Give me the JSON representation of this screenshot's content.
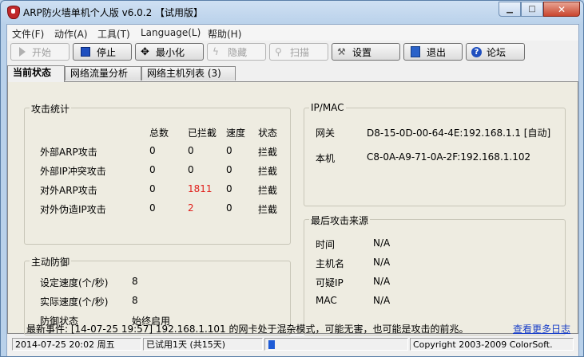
{
  "window": {
    "title": "ARP防火墙单机个人版 v6.0.2 【试用版】"
  },
  "menu": [
    "文件(F)",
    "动作(A)",
    "工具(T)",
    "Language(L)",
    "帮助(H)"
  ],
  "toolbar": {
    "start": "开始",
    "stop": "停止",
    "minimize": "最小化",
    "hide": "隐藏",
    "scan": "扫描",
    "settings": "设置",
    "exit": "退出",
    "forum": "论坛"
  },
  "tabs": [
    "当前状态",
    "网络流量分析",
    "网络主机列表 (3)"
  ],
  "attack_stats": {
    "title": "攻击统计",
    "headers": [
      "总数",
      "已拦截",
      "速度",
      "状态"
    ],
    "rows": [
      {
        "name": "外部ARP攻击",
        "total": "0",
        "blocked": "0",
        "speed": "0",
        "status": "拦截"
      },
      {
        "name": "外部IP冲突攻击",
        "total": "0",
        "blocked": "0",
        "speed": "0",
        "status": "拦截"
      },
      {
        "name": "对外ARP攻击",
        "total": "0",
        "blocked": "1811",
        "speed": "0",
        "status": "拦截"
      },
      {
        "name": "对外伪造IP攻击",
        "total": "0",
        "blocked": "2",
        "speed": "0",
        "status": "拦截"
      }
    ]
  },
  "ipmac": {
    "title": "IP/MAC",
    "gateway_label": "网关",
    "gateway_value": "D8-15-0D-00-64-4E:192.168.1.1 [自动]",
    "local_label": "本机",
    "local_value": "C8-0A-A9-71-0A-2F:192.168.1.102"
  },
  "defense": {
    "title": "主动防御",
    "set_speed_label": "设定速度(个/秒)",
    "set_speed_value": "8",
    "actual_speed_label": "实际速度(个/秒)",
    "actual_speed_value": "8",
    "state_label": "防御状态",
    "state_value": "始终启用"
  },
  "last_attack": {
    "title": "最后攻击来源",
    "time_label": "时间",
    "time_value": "N/A",
    "host_label": "主机名",
    "host_value": "N/A",
    "ip_label": "可疑IP",
    "ip_value": "N/A",
    "mac_label": "MAC",
    "mac_value": "N/A"
  },
  "latest_event": "最新事件: [14-07-25 19:57] 192.168.1.101 的网卡处于混杂模式，可能无害，也可能是攻击的前兆。",
  "more_log_link": "查看更多日志",
  "status": {
    "datetime": "2014-07-25 20:02 周五",
    "trial": "已试用1天 (共15天)",
    "copyright": "Copyright 2003-2009 ColorSoft."
  },
  "colors": {
    "blocked_highlight": "#e0201c",
    "link": "#1a3fc8"
  }
}
